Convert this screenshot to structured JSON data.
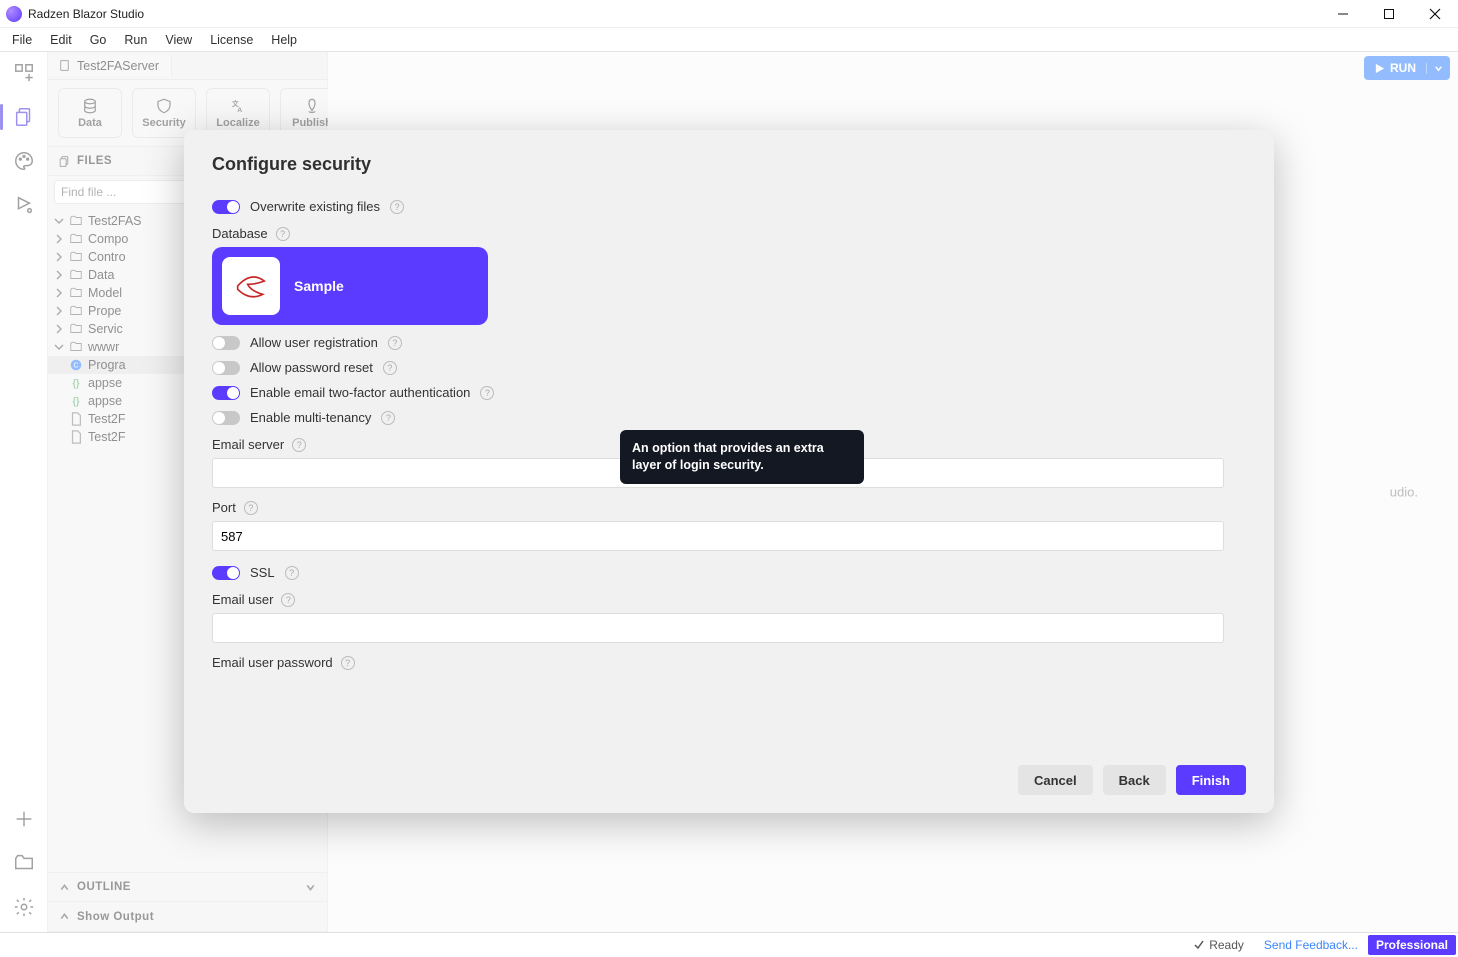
{
  "app": {
    "title": "Radzen Blazor Studio"
  },
  "menu": [
    "File",
    "Edit",
    "Go",
    "Run",
    "View",
    "License",
    "Help"
  ],
  "run_button": {
    "label": "RUN"
  },
  "rail": {
    "icons": [
      "add-component",
      "files",
      "palette",
      "extensions"
    ],
    "bottom": [
      "new",
      "open",
      "settings"
    ]
  },
  "sidebar": {
    "tab_label": "Test2FAServer",
    "tool_buttons": [
      "Data",
      "Security",
      "Localize",
      "Publish"
    ],
    "files_header": "FILES",
    "find_placeholder": "Find file ...",
    "tree": [
      {
        "d": 0,
        "t": "folder",
        "open": true,
        "label": "Test2FAS"
      },
      {
        "d": 1,
        "t": "folder",
        "label": "Compo"
      },
      {
        "d": 1,
        "t": "folder",
        "label": "Contro"
      },
      {
        "d": 1,
        "t": "folder",
        "label": "Data"
      },
      {
        "d": 1,
        "t": "folder",
        "label": "Model"
      },
      {
        "d": 1,
        "t": "folder",
        "label": "Prope"
      },
      {
        "d": 1,
        "t": "folder",
        "label": "Servic"
      },
      {
        "d": 1,
        "t": "folder",
        "open": true,
        "label": "wwwr"
      },
      {
        "d": 2,
        "t": "cs",
        "label": "Progra",
        "sel": true
      },
      {
        "d": 2,
        "t": "json",
        "label": "appse"
      },
      {
        "d": 2,
        "t": "json",
        "label": "appse"
      },
      {
        "d": 2,
        "t": "file",
        "label": "Test2F"
      },
      {
        "d": 2,
        "t": "file",
        "label": "Test2F"
      }
    ],
    "outline_header": "OUTLINE",
    "show_output": "Show Output"
  },
  "center": {
    "hint": "udio."
  },
  "status": {
    "ready": "Ready",
    "feedback": "Send Feedback...",
    "badge": "Professional"
  },
  "dialog": {
    "title": "Configure security",
    "overwrite": {
      "label": "Overwrite existing files",
      "on": true
    },
    "database_label": "Database",
    "db_card": {
      "name": "Sample"
    },
    "allow_reg": {
      "label": "Allow user registration",
      "on": false
    },
    "allow_reset": {
      "label": "Allow password reset",
      "on": false
    },
    "enable_2fa": {
      "label": "Enable email two-factor authentication",
      "on": true,
      "tooltip": "An option that provides an extra layer of login security."
    },
    "multi_tenancy": {
      "label": "Enable multi-tenancy",
      "on": false
    },
    "email_server": {
      "label": "Email server",
      "value": ""
    },
    "port": {
      "label": "Port",
      "value": "587"
    },
    "ssl": {
      "label": "SSL",
      "on": true
    },
    "email_user": {
      "label": "Email user",
      "value": ""
    },
    "email_pass": {
      "label": "Email user password",
      "value": ""
    },
    "buttons": {
      "cancel": "Cancel",
      "back": "Back",
      "finish": "Finish"
    }
  }
}
